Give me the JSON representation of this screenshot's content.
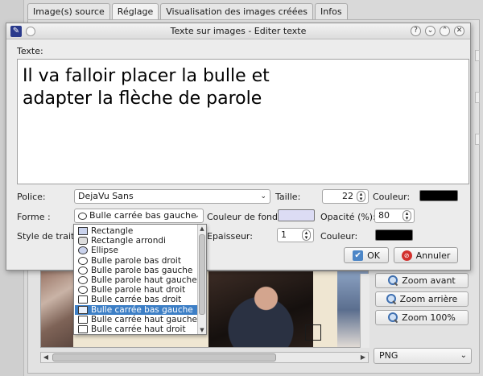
{
  "main": {
    "tabs": [
      {
        "label": "Image(s) source",
        "active": false
      },
      {
        "label": "Réglage",
        "active": true
      },
      {
        "label": "Visualisation des images créées",
        "active": false
      },
      {
        "label": "Infos",
        "active": false
      }
    ],
    "zoom_in_label": "Zoom avant",
    "zoom_out_label": "Zoom arrière",
    "zoom_100_label": "Zoom 100%",
    "format_value": "PNG"
  },
  "dialog": {
    "title": "Texte sur images - Editer texte",
    "text_label": "Texte:",
    "text_value": "Il va falloir placer la bulle et\nadapter la flèche de parole",
    "police_label": "Police:",
    "police_value": "DejaVu Sans",
    "taille_label": "Taille:",
    "taille_value": "22",
    "couleur_label": "Couleur:",
    "couleur_value": "#000000",
    "forme_label": "Forme :",
    "forme_value": "Bulle carrée bas gauche",
    "couleur_fond_label": "Couleur de fond:",
    "couleur_fond_value": "#dcdcf4",
    "opacite_label": "Opacité (%):",
    "opacite_value": "80",
    "style_trait_label": "Style de trait:",
    "epaisseur_label": "Epaisseur:",
    "epaisseur_value": "1",
    "couleur2_label": "Couleur:",
    "couleur2_value": "#000000",
    "ok_label": "OK",
    "cancel_label": "Annuler",
    "help_button": "?"
  },
  "forme_options": [
    {
      "label": "Rectangle",
      "icon": "rectangle-icon",
      "selected": false
    },
    {
      "label": "Rectangle arrondi",
      "icon": "rounded-rectangle-icon",
      "selected": false
    },
    {
      "label": "Ellipse",
      "icon": "ellipse-icon",
      "selected": false
    },
    {
      "label": "Bulle parole bas droit",
      "icon": "speech-bubble-icon",
      "selected": false
    },
    {
      "label": "Bulle parole bas gauche",
      "icon": "speech-bubble-icon",
      "selected": false
    },
    {
      "label": "Bulle parole haut gauche",
      "icon": "speech-bubble-icon",
      "selected": false
    },
    {
      "label": "Bulle parole haut droit",
      "icon": "speech-bubble-icon",
      "selected": false
    },
    {
      "label": "Bulle carrée bas droit",
      "icon": "square-bubble-icon",
      "selected": false
    },
    {
      "label": "Bulle carrée bas gauche",
      "icon": "square-bubble-icon",
      "selected": true
    },
    {
      "label": "Bulle carrée haut gauche",
      "icon": "square-bubble-icon",
      "selected": false
    },
    {
      "label": "Bulle carrée haut droit",
      "icon": "square-bubble-icon",
      "selected": false
    }
  ]
}
